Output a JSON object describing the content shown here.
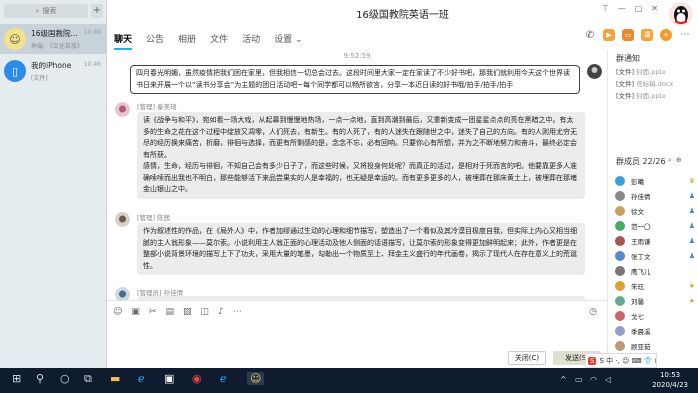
{
  "sidebar": {
    "search_placeholder": "搜索",
    "add_label": "+",
    "conversations": [
      {
        "name": "16级国教院...",
        "last": "仲瑞: 《文化苦旅》",
        "time": "10:49"
      },
      {
        "name": "我的iPhone",
        "last": "[文件]",
        "time": "10:46"
      }
    ]
  },
  "window": {
    "title": "16级国教院英语一班"
  },
  "tabs": [
    {
      "label": "聊天"
    },
    {
      "label": "公告"
    },
    {
      "label": "相册"
    },
    {
      "label": "文件"
    },
    {
      "label": "活动"
    },
    {
      "label": "设置 ⌄"
    }
  ],
  "chat": {
    "timestamp": "9:52:59",
    "my_message": "四月春光明媚，虽然疫情把我们困在家里，但我相信一切总会过去。这段时间里大家一定在家读了不少好书吧，那我们就利用今天这个世界读书日来开展一个以“读书分享会”为主题的团日活动吧~每个同学都可以畅所欲言，分享一本近日读的好书哦/拍手/拍手/拍手",
    "messages": [
      {
        "tag": "[管理]",
        "sender": "秦美琦",
        "text": "读《战争与和平》，宛如看一场大戏，从起幕到慢慢地热场，一点一点地，直到高潮到最后，又重新变成一团星星点点的亮在黑暗之中。有太多的生命之花在这个过程中绽放又凋零，人们死去，有新生。有的人死了，有的人迷失在跟随世之中，迷失了自己的方向。有的人则用尤穷无尽的经历换来痛苦，折磨，徘徊与选择，而更有所剩感的是，念念不忘，必有回响。只要你心有所想，并为之不断地努力和奋斗，最终必定会有所获。\n感情，生命，经历与徘徊，不知自己会有多少日子了，而这些时候，又将投身何处呢？而真正的活过，是相对于死而言的吧。他要靠更多人准确嗦嗦而出我也不明白，那些能够活下来品尝果实的人是幸福的，也无疑是幸运的。而有更多更多的人，被埋葬在那床黄土上，被埋葬在那堵金山银山之中。"
      },
      {
        "tag": "[管理]",
        "sender": "陈茜",
        "text": "作为叙述性的作品，在《局外人》中，作者加缪通过生动的心理和细节描写，塑造出了一个看似及其冷漠目极度自我，但实际上内心又相当细腻的主人翁形象——莫尔索。小说利用主人翁正面的心理活动及他人侧面的话语描写，让莫尔索的形象变得更加鲜明起来；此外，作者更是在整部小说背景环境的描写上下了功夫，采用大量的笔墨，勾勒出一个物质至上、拜金主义盛行的年代画卷，揭示了现代人在存在意义上的荒诞性。"
      },
      {
        "tag": "[管理员]",
        "sender": "孙佳倩",
        "text": ""
      }
    ]
  },
  "input": {
    "close_label": "关闭(C)",
    "send_label": "发送(S)"
  },
  "right_panel": {
    "notice_title": "群通知",
    "files": [
      {
        "prefix": "[文件]",
        "name": "封面.pptx"
      },
      {
        "prefix": "[文件]",
        "name": "竞标稿.docx"
      },
      {
        "prefix": "[文件]",
        "name": "封面.pptx"
      }
    ],
    "members_label": "群成员 22/26",
    "members": [
      {
        "name": "彭曦",
        "color": "#3aa0e0"
      },
      {
        "name": "孙佳倩",
        "color": "#888"
      },
      {
        "name": "徐文",
        "color": "#c8a060"
      },
      {
        "name": "范一〇",
        "color": "#4a6"
      },
      {
        "name": "王雨谦",
        "color": "#a55"
      },
      {
        "name": "张丁文",
        "color": "#58c"
      },
      {
        "name": "鹰飞儿",
        "color": "#777"
      },
      {
        "name": "朱珏",
        "color": "#e0a030"
      },
      {
        "name": "刘馨",
        "color": "#6a8"
      },
      {
        "name": "戈七",
        "color": "#c66"
      },
      {
        "name": "季晨溪",
        "color": "#99c"
      },
      {
        "name": "顾亚茹",
        "color": "#b97"
      }
    ]
  },
  "ime": {
    "label": "S 中 ·, ☺ ⌨ 👕 ⊞"
  },
  "taskbar": {
    "time": "10:53",
    "date": "2020/4/23"
  }
}
